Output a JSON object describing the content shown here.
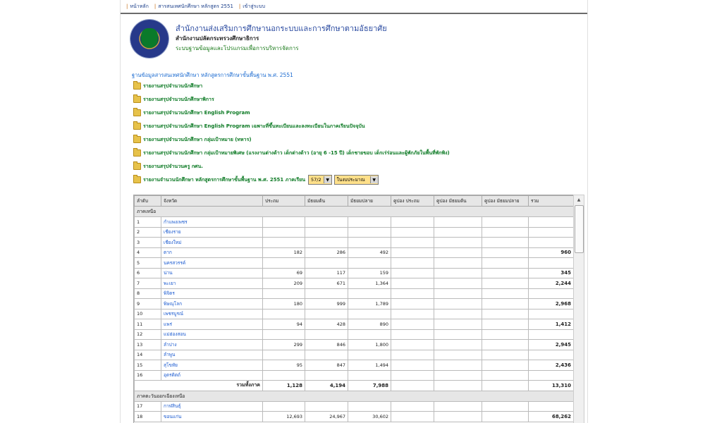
{
  "nav": {
    "items": [
      "หน้าหลัก",
      "สารสนเทศนักศึกษา หลักสูตร 2551",
      "เข้าสู่ระบบ"
    ]
  },
  "header": {
    "title": "สำนักงานส่งเสริมการศึกษานอกระบบและการศึกษาตามอัธยาศัย",
    "sub1": "สำนักงานปลัดกระทรวงศึกษาธิการ",
    "sub2": "ระบบฐานข้อมูลและโปรแกรมเพื่อการบริหารจัดการ"
  },
  "db_title": "ฐานข้อมูลสารสนเทศนักศึกษา หลักสูตรการศึกษาขั้นพื้นฐาน พ.ศ. 2551",
  "reports": [
    "รายงานสรุปจำนวนนักศึกษา",
    "รายงานสรุปจำนวนนักศึกษาพิการ",
    "รายงานสรุปจำนวนนักศึกษา English Program",
    "รายงานสรุปจำนวนนักศึกษา English Program เฉพาะที่ขึ้นทะเบียนและลงทะเบียนในภาคเรียนปัจจุบัน",
    "รายงานสรุปจำนวนนักศึกษา กลุ่มเป้าหมาย (ทหาร)",
    "รายงานสรุปจำนวนนักศึกษา กลุ่มเป้าหมายพิเศษ (แรงงานต่างด้าว เด็กต่างด้าว (อายุ 6 -15 ปี) เด็กชายขอบ เด็กเร่ร่อนและผู้พักภัยในพื้นที่พักพิง)",
    "รายงานสรุปจำนวนครู กศน."
  ],
  "filter": {
    "label": "รายงานจำนวนนักศึกษา หลักสูตรการศึกษาขั้นพื้นฐาน พ.ศ. 2551 ภาคเรียน",
    "term": "57/2",
    "budget": "ในงบประมาณ"
  },
  "table": {
    "headers": [
      "ลำดับ",
      "จังหวัด",
      "ประถม",
      "มัธยมต้น",
      "มัธยมปลาย",
      "คูปอง ประถม",
      "คูปอง มัธยมต้น",
      "คูปอง มัธยมปลาย",
      "รวม"
    ],
    "groups": [
      {
        "name": "ภาคเหนือ",
        "rows": [
          [
            "1",
            "กำแพงเพชร",
            "",
            "",
            "",
            "",
            "",
            "",
            ""
          ],
          [
            "2",
            "เชียงราย",
            "",
            "",
            "",
            "",
            "",
            "",
            ""
          ],
          [
            "3",
            "เชียงใหม่",
            "",
            "",
            "",
            "",
            "",
            "",
            ""
          ],
          [
            "4",
            "ตาก",
            "182",
            "286",
            "492",
            "",
            "",
            "",
            "960"
          ],
          [
            "5",
            "นครสวรรค์",
            "",
            "",
            "",
            "",
            "",
            "",
            ""
          ],
          [
            "6",
            "น่าน",
            "69",
            "117",
            "159",
            "",
            "",
            "",
            "345"
          ],
          [
            "7",
            "พะเยา",
            "209",
            "671",
            "1,364",
            "",
            "",
            "",
            "2,244"
          ],
          [
            "8",
            "พิจิตร",
            "",
            "",
            "",
            "",
            "",
            "",
            ""
          ],
          [
            "9",
            "พิษณุโลก",
            "180",
            "999",
            "1,789",
            "",
            "",
            "",
            "2,968"
          ],
          [
            "10",
            "เพชรบูรณ์",
            "",
            "",
            "",
            "",
            "",
            "",
            ""
          ],
          [
            "11",
            "แพร่",
            "94",
            "428",
            "890",
            "",
            "",
            "",
            "1,412"
          ],
          [
            "12",
            "แม่ฮ่องสอน",
            "",
            "",
            "",
            "",
            "",
            "",
            ""
          ],
          [
            "13",
            "ลำปาง",
            "299",
            "846",
            "1,800",
            "",
            "",
            "",
            "2,945"
          ],
          [
            "14",
            "ลำพูน",
            "",
            "",
            "",
            "",
            "",
            "",
            ""
          ],
          [
            "15",
            "สุโขทัย",
            "95",
            "847",
            "1,494",
            "",
            "",
            "",
            "2,436"
          ],
          [
            "16",
            "อุตรดิตถ์",
            "",
            "",
            "",
            "",
            "",
            "",
            ""
          ]
        ],
        "subtotal": [
          "รวมทั้งภาค",
          "1,128",
          "4,194",
          "7,988",
          "",
          "",
          "",
          "13,310"
        ]
      },
      {
        "name": "ภาคตะวันออกเฉียงเหนือ",
        "rows": [
          [
            "17",
            "กาฬสินธุ์",
            "",
            "",
            "",
            "",
            "",
            "",
            ""
          ],
          [
            "18",
            "ขอนแก่น",
            "12,693",
            "24,967",
            "30,602",
            "",
            "",
            "",
            "68,262"
          ]
        ]
      }
    ]
  }
}
